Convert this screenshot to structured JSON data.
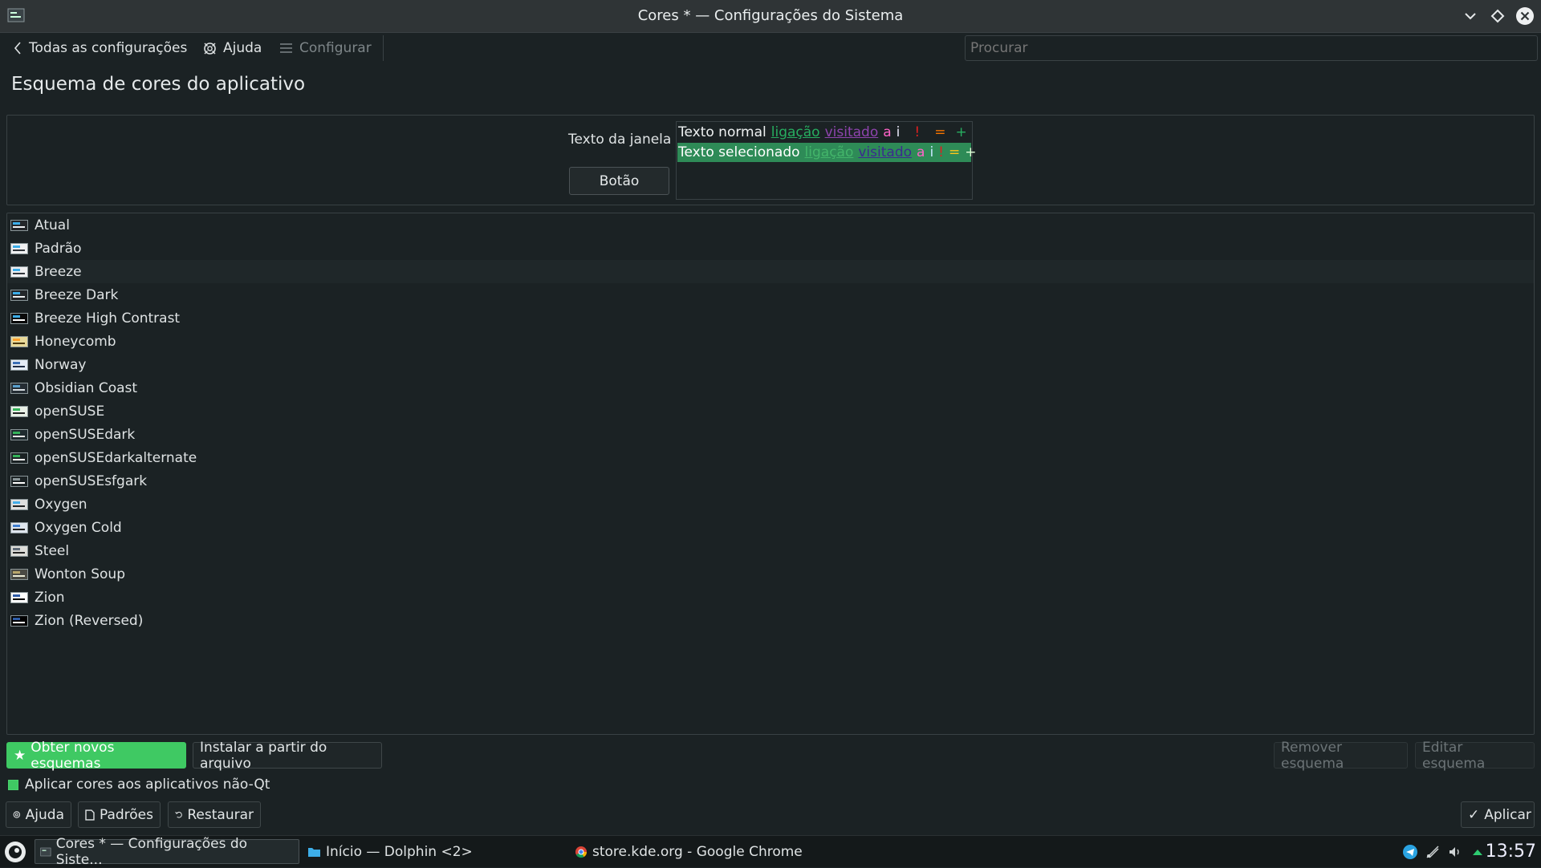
{
  "window": {
    "title": "Cores * — Configurações do Sistema"
  },
  "toolbar": {
    "back_label": "Todas as configurações",
    "help_label": "Ajuda",
    "configure_label": "Configurar",
    "search_placeholder": "Procurar"
  },
  "page": {
    "title": "Esquema de cores do aplicativo"
  },
  "preview": {
    "window_text_label": "Texto da janela",
    "button_label": "Botão",
    "normal": {
      "text": "Texto normal",
      "link": "ligação",
      "visited": "visitado",
      "a": "a",
      "i": "i",
      "excl": "!",
      "eq": "=",
      "plus": "+"
    },
    "selected": {
      "text": "Texto selecionado",
      "link": "ligação",
      "visited": "visitado",
      "a": "a",
      "i": "i",
      "excl": "!",
      "eq": "=",
      "plus": "+"
    }
  },
  "schemes": [
    "Atual",
    "Padrão",
    "Breeze",
    "Breeze Dark",
    "Breeze High Contrast",
    "Honeycomb",
    "Norway",
    "Obsidian Coast",
    "openSUSE",
    "openSUSEdark",
    "openSUSEdarkalternate",
    "openSUSEsfgark",
    "Oxygen",
    "Oxygen Cold",
    "Steel",
    "Wonton Soup",
    "Zion",
    "Zion (Reversed)"
  ],
  "actions": {
    "get_new": "Obter novos esquemas",
    "install_file": "Instalar a partir do arquivo",
    "remove": "Remover esquema",
    "edit": "Editar esquema",
    "apply_non_qt": "Aplicar cores aos aplicativos não-Qt"
  },
  "footer": {
    "help": "Ajuda",
    "defaults": "Padrões",
    "reset": "Restaurar",
    "apply": "Aplicar"
  },
  "taskbar": {
    "tasks": [
      "Cores * — Configurações do Siste...",
      "Início — Dolphin <2>",
      "store.kde.org - Google Chrome"
    ],
    "clock": "13:57"
  },
  "colors": {
    "accent": "#3fc963",
    "selection": "#2e8b57",
    "link": "#27ae60",
    "visited": "#8e44ad",
    "background": "#1b2224"
  }
}
